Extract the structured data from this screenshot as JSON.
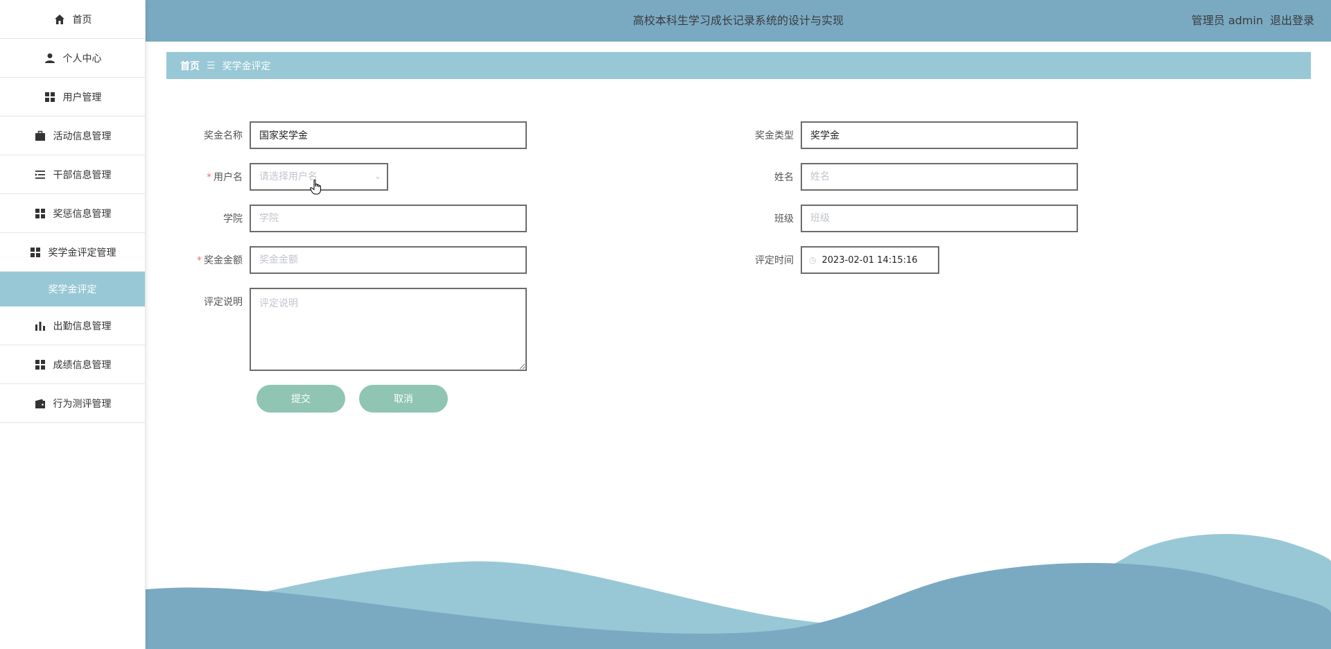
{
  "sidebar": {
    "items": [
      {
        "label": "首页",
        "icon": "home-icon"
      },
      {
        "label": "个人中心",
        "icon": "user-icon"
      },
      {
        "label": "用户管理",
        "icon": "grid-icon"
      },
      {
        "label": "活动信息管理",
        "icon": "briefcase-icon"
      },
      {
        "label": "干部信息管理",
        "icon": "list-indent-icon"
      },
      {
        "label": "奖惩信息管理",
        "icon": "grid-icon"
      },
      {
        "label": "奖学金评定管理",
        "icon": "grid-icon"
      },
      {
        "label": "出勤信息管理",
        "icon": "bar-chart-icon"
      },
      {
        "label": "成绩信息管理",
        "icon": "grid-icon"
      },
      {
        "label": "行为测评管理",
        "icon": "wallet-icon"
      }
    ],
    "active_sub": "奖学金评定"
  },
  "header": {
    "title": "高校本科生学习成长记录系统的设计与实现",
    "user_label": "管理员 admin",
    "logout": "退出登录"
  },
  "breadcrumb": {
    "home": "首页",
    "separator": "☰",
    "current": "奖学金评定"
  },
  "form": {
    "scholarship_name": {
      "label": "奖金名称",
      "value": "国家奖学金"
    },
    "scholarship_type": {
      "label": "奖金类型",
      "value": "奖学金"
    },
    "username": {
      "label": "用户名",
      "placeholder": "请选择用户名",
      "required": true
    },
    "name": {
      "label": "姓名",
      "placeholder": "姓名"
    },
    "college": {
      "label": "学院",
      "placeholder": "学院"
    },
    "class": {
      "label": "班级",
      "placeholder": "班级"
    },
    "amount": {
      "label": "奖金金额",
      "placeholder": "奖金金额",
      "required": true
    },
    "eval_time": {
      "label": "评定时间",
      "value": "2023-02-01 14:15:16"
    },
    "description": {
      "label": "评定说明",
      "placeholder": "评定说明"
    }
  },
  "buttons": {
    "submit": "提交",
    "cancel": "取消"
  },
  "colors": {
    "header": "#7aaac2",
    "breadcrumb": "#98c8d6",
    "button": "#8fc5b2",
    "wave_light": "#98c8d6",
    "wave_dark": "#7aaac2"
  }
}
